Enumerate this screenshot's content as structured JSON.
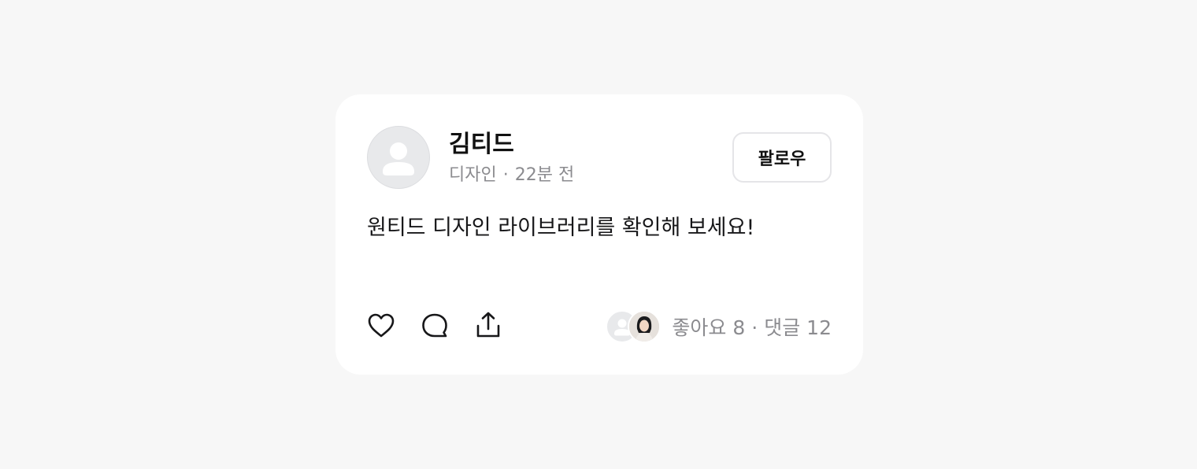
{
  "post": {
    "author_name": "김티드",
    "category": "디자인",
    "separator": "·",
    "time_ago": "22분 전",
    "follow_label": "팔로우",
    "content": "원티드 디자인 라이브러리를 확인해 보세요!",
    "likes_label": "좋아요 8",
    "comments_label": "댓글 12"
  },
  "icons": {
    "avatar": "person-icon",
    "like": "heart-icon",
    "comment": "comment-icon",
    "share": "share-icon"
  },
  "colors": {
    "background": "#f7f7f7",
    "card": "#ffffff",
    "primary_text": "#171719",
    "secondary_text": "#8b8b8f",
    "border": "#e5e5e8"
  }
}
